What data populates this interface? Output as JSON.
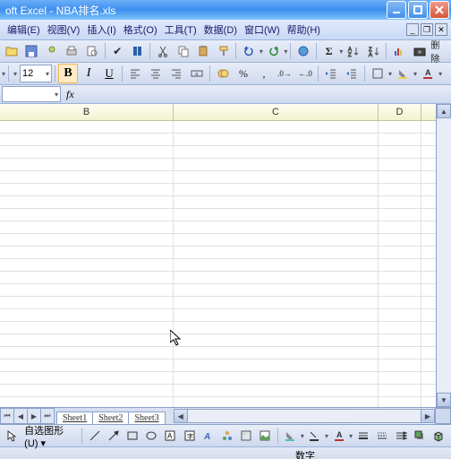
{
  "title": "oft Excel - NBA排名.xls",
  "menu": {
    "edit": "编辑(E)",
    "view": "视图(V)",
    "insert": "插入(I)",
    "format": "格式(O)",
    "tools": "工具(T)",
    "data": "数据(D)",
    "window": "窗口(W)",
    "help": "帮助(H)"
  },
  "font_size": "12",
  "bold": "B",
  "italic": "I",
  "underline": "U",
  "name_box": "",
  "tabs": {
    "s1": "Sheet1",
    "s2": "Sheet2",
    "s3": "Sheet3"
  },
  "columns": {
    "b": "B",
    "c": "C",
    "d": "D"
  },
  "autoshape": "自选图形(U)",
  "status_mode": "数字",
  "sigma": "Σ",
  "delete_label": "删除"
}
